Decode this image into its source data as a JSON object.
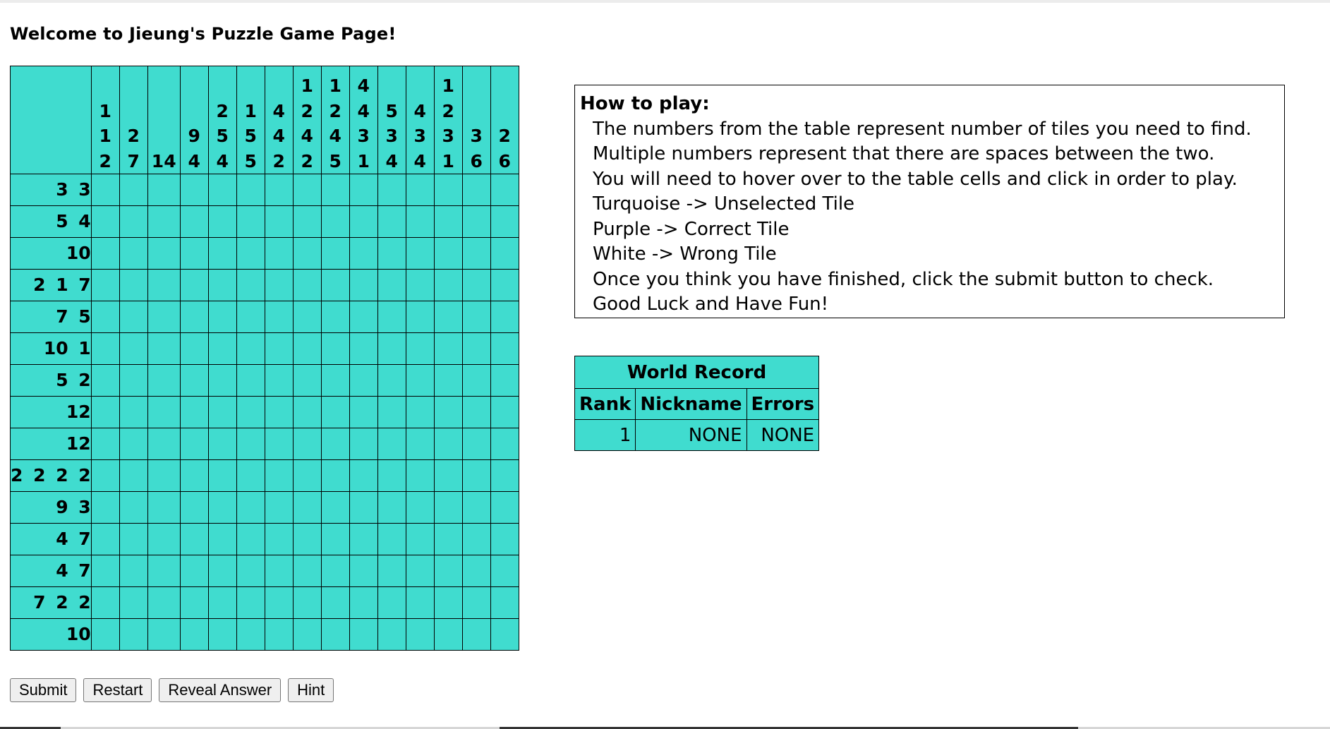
{
  "page": {
    "title": "Welcome to Jieung's Puzzle Game Page!"
  },
  "puzzle": {
    "column_clues": [
      [
        "1",
        "1",
        "2"
      ],
      [
        "2",
        "7"
      ],
      [
        "14"
      ],
      [
        "9",
        "4"
      ],
      [
        "2",
        "5",
        "4"
      ],
      [
        "1",
        "5",
        "5"
      ],
      [
        "4",
        "4",
        "2"
      ],
      [
        "1",
        "2",
        "4",
        "2"
      ],
      [
        "1",
        "2",
        "4",
        "5"
      ],
      [
        "4",
        "4",
        "3",
        "1"
      ],
      [
        "5",
        "3",
        "4"
      ],
      [
        "4",
        "3",
        "4"
      ],
      [
        "1",
        "2",
        "3",
        "1"
      ],
      [
        "3",
        "6"
      ],
      [
        "2",
        "6"
      ]
    ],
    "row_clues": [
      "3 3",
      "5 4",
      "10",
      "2 1 7",
      "7 5",
      "10 1",
      "5 2",
      "12",
      "12",
      "2 2 2 2",
      "9 3",
      "4 7",
      "4 7",
      "7 2 2",
      "10"
    ],
    "colors": {
      "unselected": "#40dccf"
    }
  },
  "instructions": {
    "title": "How to play:",
    "lines": [
      "The numbers from the table represent number of tiles you need to find.",
      "Multiple numbers represent that there are spaces between the two.",
      "You will need to hover over to the table cells and click in order to play.",
      "Turquoise -> Unselected Tile",
      "Purple -> Correct Tile",
      "White -> Wrong Tile",
      "Once you think you have finished, click the submit button to check.",
      "Good Luck and Have Fun!"
    ]
  },
  "record": {
    "title": "World Record",
    "headers": [
      "Rank",
      "Nickname",
      "Errors"
    ],
    "rows": [
      {
        "rank": "1",
        "nickname": "NONE",
        "errors": "NONE"
      }
    ]
  },
  "buttons": {
    "submit": "Submit",
    "restart": "Restart",
    "reveal": "Reveal Answer",
    "hint": "Hint"
  }
}
